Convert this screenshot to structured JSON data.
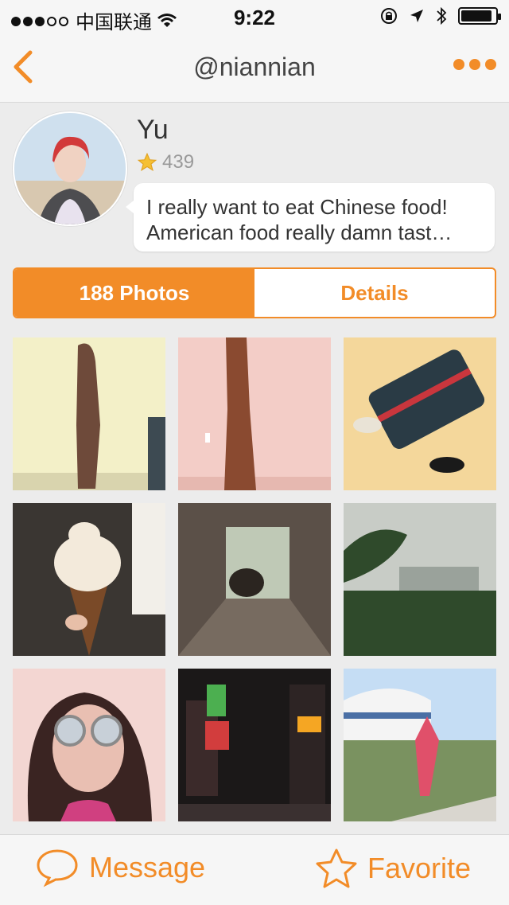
{
  "status_bar": {
    "carrier": "中国联通",
    "time": "9:22",
    "signal_bars": 3,
    "battery_level": 0.9,
    "icons": [
      "wifi-icon",
      "rotation-lock-icon",
      "location-icon",
      "bluetooth-icon",
      "battery-icon"
    ]
  },
  "nav": {
    "title": "@niannian",
    "back_icon": "chevron-left-icon",
    "more_icon": "more-dots-icon"
  },
  "profile": {
    "name": "Yu",
    "score": "439",
    "status_line1": "I really want to eat Chinese food!",
    "status_line2": "American food really damn tast…"
  },
  "tabs": {
    "photos": "188 Photos",
    "details": "Details"
  },
  "photos": [
    {
      "subject": "leopard dress against yellow wall",
      "palette": [
        "#f3f0c8",
        "#6e4a3a"
      ]
    },
    {
      "subject": "leopard dress against pink wall",
      "palette": [
        "#f3cdc7",
        "#8a4a30"
      ]
    },
    {
      "subject": "luggage and shoes on yellow floor",
      "palette": [
        "#f4d79b",
        "#2a3b45"
      ]
    },
    {
      "subject": "ice cream cone",
      "palette": [
        "#3a3632",
        "#f3eadb"
      ]
    },
    {
      "subject": "cat in stone tunnel",
      "palette": [
        "#5b5048",
        "#2b2520"
      ]
    },
    {
      "subject": "hazy city view with trees",
      "palette": [
        "#c8ccc6",
        "#2f4a2b"
      ]
    },
    {
      "subject": "selfie with round sunglasses",
      "palette": [
        "#f3d6d2",
        "#3a2422"
      ]
    },
    {
      "subject": "neon street at night",
      "palette": [
        "#1b1818",
        "#d23d3d"
      ]
    },
    {
      "subject": "yurt and woman in red",
      "palette": [
        "#c5ddf4",
        "#7a9260"
      ]
    }
  ],
  "bottom_bar": {
    "message": "Message",
    "favorite": "Favorite"
  },
  "colors": {
    "accent": "#f28c28",
    "background": "#ececec",
    "bar": "#f6f6f6"
  }
}
